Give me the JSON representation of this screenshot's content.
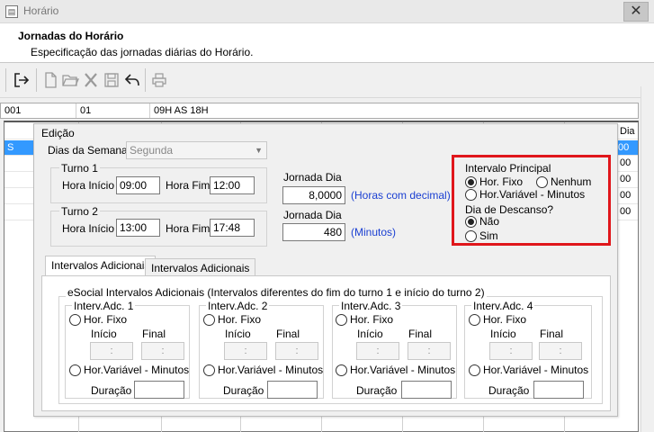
{
  "window": {
    "title": "Horário",
    "close_glyph": "✕"
  },
  "header": {
    "title": "Jornadas do Horário",
    "subtitle": "Especificação das jornadas diárias do Horário."
  },
  "toolbar": {
    "icons": [
      "exit-icon",
      "new-document-icon",
      "open-folder-icon",
      "delete-icon",
      "save-icon",
      "undo-icon",
      "print-icon"
    ]
  },
  "info_row": {
    "code": "001",
    "seq": "01",
    "description": "09H AS 18H"
  },
  "grid": {
    "header_dia": "Dia",
    "selected_cell": "S",
    "row_values": [
      "00",
      "00",
      "00",
      "00",
      "00"
    ]
  },
  "edit": {
    "title": "Edição",
    "dias_semana_label": "Dias da Semana",
    "dias_semana_value": "Segunda",
    "turno1": {
      "title": "Turno 1",
      "inicio_label": "Hora Início",
      "inicio": "09:00",
      "fim_label": "Hora Fim",
      "fim": "12:00"
    },
    "turno2": {
      "title": "Turno 2",
      "inicio_label": "Hora Início",
      "inicio": "13:00",
      "fim_label": "Hora Fim",
      "fim": "17:48"
    },
    "jornada1": {
      "label": "Jornada Dia",
      "value": "8,0000",
      "unit": "(Horas com decimal)"
    },
    "jornada2": {
      "label": "Jornada Dia",
      "value": "480",
      "unit": "(Minutos)"
    },
    "intervalo_principal": {
      "title": "Intervalo Principal",
      "opt_fixo": "Hor. Fixo",
      "opt_nenhum": "Nenhum",
      "opt_variavel": "Hor.Variável - Minutos",
      "selected": "Hor. Fixo"
    },
    "dia_descanso": {
      "title": "Dia de Descanso?",
      "opt_nao": "Não",
      "opt_sim": "Sim",
      "selected": "Não"
    },
    "highlight_color": "#e0161b"
  },
  "tabs": [
    "Intervalos Adicionais",
    "Intervalos Adicionais"
  ],
  "esocial": {
    "title": "eSocial Intervalos Adicionais  (Intervalos diferentes do fim do turno 1 e início do turno 2)",
    "groups": [
      {
        "title": "Interv.Adc. 1",
        "fixo": "Hor. Fixo",
        "inicio": "Início",
        "final": "Final",
        "time_placeholder": ":",
        "variavel": "Hor.Variável - Minutos",
        "duracao": "Duração"
      },
      {
        "title": "Interv.Adc. 2",
        "fixo": "Hor. Fixo",
        "inicio": "Início",
        "final": "Final",
        "time_placeholder": ":",
        "variavel": "Hor.Variável - Minutos",
        "duracao": "Duração"
      },
      {
        "title": "Interv.Adc. 3",
        "fixo": "Hor. Fixo",
        "inicio": "Início",
        "final": "Final",
        "time_placeholder": ":",
        "variavel": "Hor.Variável - Minutos",
        "duracao": "Duração"
      },
      {
        "title": "Interv.Adc. 4",
        "fixo": "Hor. Fixo",
        "inicio": "Início",
        "final": "Final",
        "time_placeholder": ":",
        "variavel": "Hor.Variável - Minutos",
        "duracao": "Duração"
      }
    ]
  }
}
